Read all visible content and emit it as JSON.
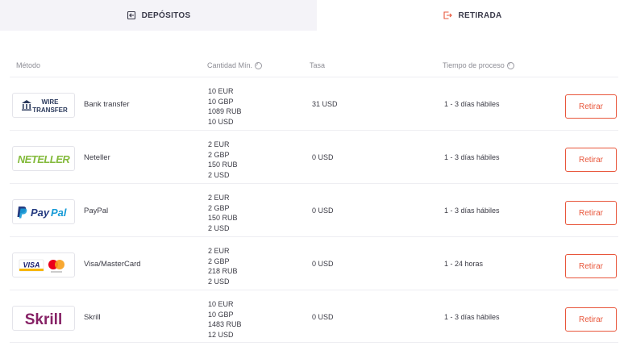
{
  "tabs": {
    "deposits": "DEPÓSITOS",
    "withdrawal": "RETIRADA"
  },
  "table": {
    "headers": {
      "method": "Método",
      "min_amount": "Cantidad Mín.",
      "fee": "Tasa",
      "processing_time": "Tiempo de proceso"
    },
    "help_glyph": "?",
    "rows": [
      {
        "logo": "wire-transfer-logo",
        "logo_text": "WIRE TRANSFER",
        "name": "Bank transfer",
        "amounts": [
          "10 EUR",
          "10 GBP",
          "1089 RUB",
          "10 USD"
        ],
        "fee": "31 USD",
        "time": "1 - 3 días hábiles",
        "button": "Retirar"
      },
      {
        "logo": "neteller-logo",
        "logo_text": "NETELLER",
        "name": "Neteller",
        "amounts": [
          "2 EUR",
          "2 GBP",
          "150 RUB",
          "2 USD"
        ],
        "fee": "0 USD",
        "time": "1 - 3 días hábiles",
        "button": "Retirar"
      },
      {
        "logo": "paypal-logo",
        "logo_text": "PayPal",
        "name": "PayPal",
        "amounts": [
          "2 EUR",
          "2 GBP",
          "150 RUB",
          "2 USD"
        ],
        "fee": "0 USD",
        "time": "1 - 3 días hábiles",
        "button": "Retirar"
      },
      {
        "logo": "visa-mastercard-logo",
        "logo_text": "VISA",
        "name": "Visa/MasterCard",
        "amounts": [
          "2 EUR",
          "2 GBP",
          "218 RUB",
          "2 USD"
        ],
        "fee": "0 USD",
        "time": "1 - 24 horas",
        "button": "Retirar"
      },
      {
        "logo": "skrill-logo",
        "logo_text": "Skrill",
        "name": "Skrill",
        "amounts": [
          "10 EUR",
          "10 GBP",
          "1483 RUB",
          "12 USD"
        ],
        "fee": "0 USD",
        "time": "1 - 3 días hábiles",
        "button": "Retirar"
      }
    ]
  },
  "colors": {
    "accent": "#e8563b",
    "tab_active_bg": "#f4f3f8",
    "neteller": "#83ba3b",
    "paypal_dark": "#253b80",
    "paypal_light": "#179bd7",
    "visa_blue": "#1a1f71",
    "visa_gold": "#f7b600",
    "mc_red": "#eb001b",
    "mc_orange": "#f79e1b",
    "skrill": "#862165"
  }
}
